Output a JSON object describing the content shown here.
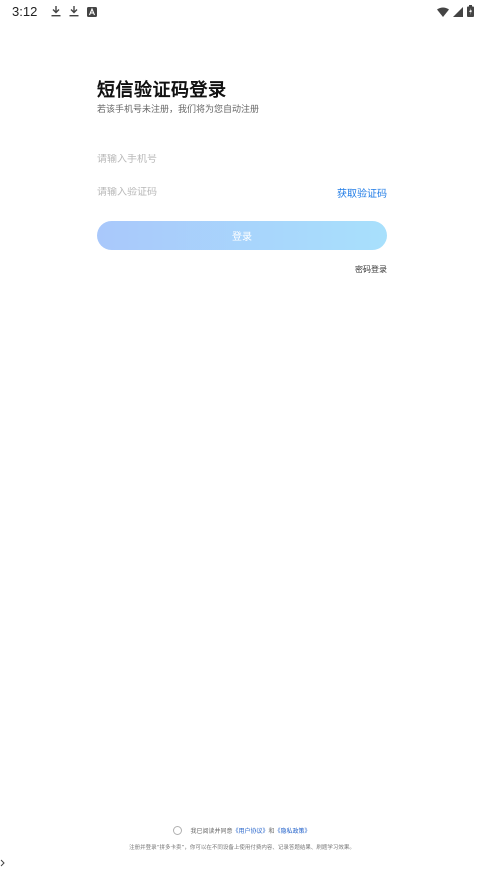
{
  "status_bar": {
    "time": "3:12",
    "left_icons": [
      "download-icon",
      "download-icon",
      "font-a-icon"
    ],
    "right_icons": [
      "wifi-icon",
      "signal-icon",
      "battery-icon"
    ]
  },
  "header": {
    "title": "短信验证码登录",
    "subtitle": "若该手机号未注册，我们将为您自动注册"
  },
  "form": {
    "phone_placeholder": "请输入手机号",
    "code_placeholder": "请输入验证码",
    "get_code_label": "获取验证码",
    "login_label": "登录",
    "password_login_label": "密码登录"
  },
  "footer": {
    "agree_prefix": "我已阅读并同意",
    "user_agreement": "《用户协议》",
    "and": "和",
    "privacy_policy": "《隐私政策》",
    "note": "注册并登录“拼多卡卖”，你可以在不同设备上使用付费内容、记录答题结果、刷题学习效果。"
  },
  "colors": {
    "accent": "#1f7be6",
    "button_gradient_start": "#a9c8fb",
    "button_gradient_end": "#a8e0fc"
  }
}
